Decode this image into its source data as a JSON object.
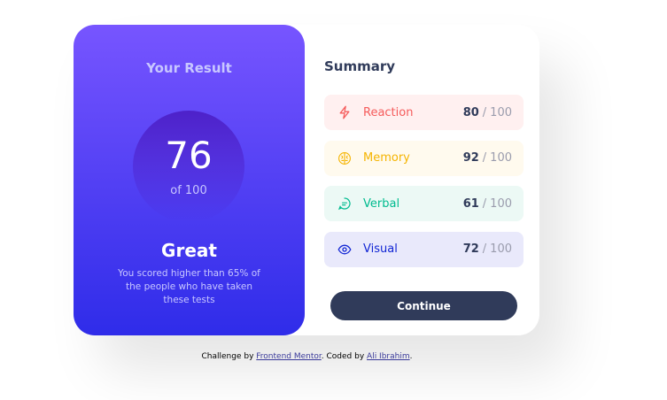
{
  "result": {
    "title": "Your Result",
    "score": "76",
    "score_of": "of 100",
    "grade": "Great",
    "description": "You scored higher than 65% of the people who have taken these tests"
  },
  "summary": {
    "title": "Summary",
    "items": [
      {
        "label": "Reaction",
        "score": "80",
        "max": "100",
        "icon": "lightning-icon",
        "color": "#F55B5B",
        "bg": "#FFF0F0"
      },
      {
        "label": "Memory",
        "score": "92",
        "max": "100",
        "icon": "brain-icon",
        "color": "#F5B400",
        "bg": "#FFFAEE"
      },
      {
        "label": "Verbal",
        "score": "61",
        "max": "100",
        "icon": "chat-icon",
        "color": "#00BB8F",
        "bg": "#ECF9F5"
      },
      {
        "label": "Visual",
        "score": "72",
        "max": "100",
        "icon": "eye-icon",
        "color": "#1125D4",
        "bg": "#E9E9FB"
      }
    ],
    "separator": "/",
    "continue_label": "Continue"
  },
  "attribution": {
    "prefix": "Challenge by",
    "link1": "Frontend Mentor",
    "middle": ". Coded by",
    "link2": "Ali Ibrahim",
    "suffix": "."
  },
  "colors": {
    "gradient_top": "#7755FF",
    "gradient_bottom": "#2F2CE9",
    "dark_navy": "#303B5A"
  }
}
